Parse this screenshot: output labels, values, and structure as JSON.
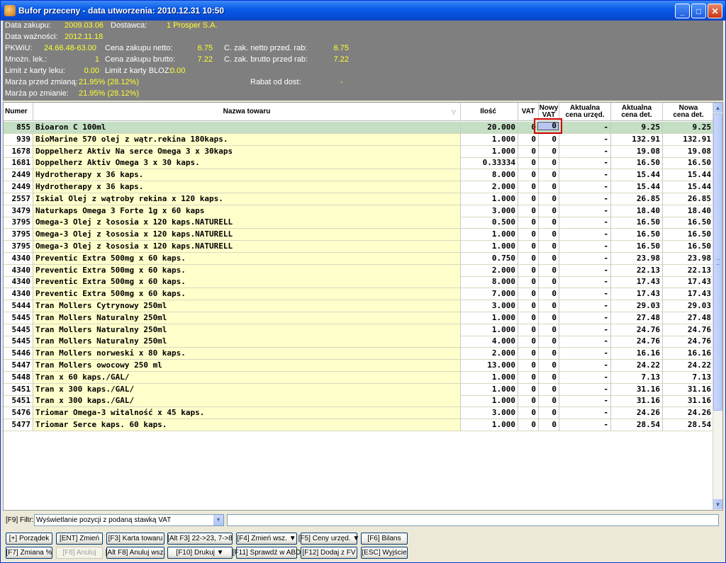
{
  "window": {
    "title": "Bufor przeceny - data utworzenia: 2010.12.31 10:50",
    "minimize": "_",
    "maximize": "□",
    "close": "✕"
  },
  "info": {
    "data_zakupu_label": "Data zakupu:",
    "data_zakupu": "2009.03.06",
    "dostawca_label": "Dostawca:",
    "dostawca": "1 Prosper S.A.",
    "data_waznosci_label": "Data ważności:",
    "data_waznosci": "2012.11.18",
    "pkwiu_label": "PKWiU:",
    "pkwiu": "24.66.48-63.00",
    "cena_netto_label": "Cena zakupu netto:",
    "cena_netto": "6.75",
    "c_zak_netto_label": "C. zak. netto przed. rab:",
    "c_zak_netto": "6.75",
    "mnozn_label": "Mnożn. lek.:",
    "mnozn": "1",
    "cena_brutto_label": "Cena zakupu brutto:",
    "cena_brutto": "7.22",
    "c_zak_brutto_label": "C. zak. brutto przed rab:",
    "c_zak_brutto": "7.22",
    "limit_leku_label": "Limit z karty leku:",
    "limit_leku": "0.00",
    "limit_bloz_label": "Limit z karty BLOZ:",
    "limit_bloz": "0.00",
    "marza_przed_label": "Marża przed zmianą:",
    "marza_przed": "21.95% (28.12%)",
    "rabat_label": "Rabat od dost:",
    "rabat": "-",
    "marza_po_label": "Marża po zmianie:",
    "marza_po": "21.95% (28.12%)"
  },
  "table": {
    "headers": {
      "numer": "Numer",
      "nazwa": "Nazwa towaru",
      "ilosc": "Ilość",
      "vat": "VAT",
      "nowy_vat_1": "Nowy",
      "nowy_vat_2": "VAT",
      "akt_urz_1": "Aktualna",
      "akt_urz_2": "cena urzęd.",
      "akt_det_1": "Aktualna",
      "akt_det_2": "cena det.",
      "nowa_det_1": "Nowa",
      "nowa_det_2": "cena det."
    },
    "rows": [
      {
        "numer": "855",
        "nazwa": "Bioaron C 100ml",
        "ilosc": "20.000",
        "vat": "0",
        "nowy_vat": "0",
        "akt_urz": "-",
        "akt_det": "9.25",
        "nowa_det": "9.25"
      },
      {
        "numer": "939",
        "nazwa": "BioMarine 570 olej z wątr.rekina 180kaps.",
        "ilosc": "1.000",
        "vat": "0",
        "nowy_vat": "0",
        "akt_urz": "-",
        "akt_det": "132.91",
        "nowa_det": "132.91"
      },
      {
        "numer": "1678",
        "nazwa": "Doppelherz Aktiv Na serce Omega 3 x 30kaps",
        "ilosc": "1.000",
        "vat": "0",
        "nowy_vat": "0",
        "akt_urz": "-",
        "akt_det": "19.08",
        "nowa_det": "19.08"
      },
      {
        "numer": "1681",
        "nazwa": "Doppelherz Aktiv Omega 3 x 30 kaps.",
        "ilosc": "0.33334",
        "vat": "0",
        "nowy_vat": "0",
        "akt_urz": "-",
        "akt_det": "16.50",
        "nowa_det": "16.50"
      },
      {
        "numer": "2449",
        "nazwa": "Hydrotherapy x 36 kaps.",
        "ilosc": "8.000",
        "vat": "0",
        "nowy_vat": "0",
        "akt_urz": "-",
        "akt_det": "15.44",
        "nowa_det": "15.44"
      },
      {
        "numer": "2449",
        "nazwa": "Hydrotherapy x 36 kaps.",
        "ilosc": "2.000",
        "vat": "0",
        "nowy_vat": "0",
        "akt_urz": "-",
        "akt_det": "15.44",
        "nowa_det": "15.44"
      },
      {
        "numer": "2557",
        "nazwa": "Iskial Olej z wątroby rekina x 120 kaps.",
        "ilosc": "1.000",
        "vat": "0",
        "nowy_vat": "0",
        "akt_urz": "-",
        "akt_det": "26.85",
        "nowa_det": "26.85"
      },
      {
        "numer": "3479",
        "nazwa": "Naturkaps Omega 3 Forte 1g x 60 kaps",
        "ilosc": "3.000",
        "vat": "0",
        "nowy_vat": "0",
        "akt_urz": "-",
        "akt_det": "18.40",
        "nowa_det": "18.40"
      },
      {
        "numer": "3795",
        "nazwa": "Omega-3 Olej z łososia x 120 kaps.NATURELL",
        "ilosc": "0.500",
        "vat": "0",
        "nowy_vat": "0",
        "akt_urz": "-",
        "akt_det": "16.50",
        "nowa_det": "16.50"
      },
      {
        "numer": "3795",
        "nazwa": "Omega-3 Olej z łososia x 120 kaps.NATURELL",
        "ilosc": "1.000",
        "vat": "0",
        "nowy_vat": "0",
        "akt_urz": "-",
        "akt_det": "16.50",
        "nowa_det": "16.50"
      },
      {
        "numer": "3795",
        "nazwa": "Omega-3 Olej z łososia x 120 kaps.NATURELL",
        "ilosc": "1.000",
        "vat": "0",
        "nowy_vat": "0",
        "akt_urz": "-",
        "akt_det": "16.50",
        "nowa_det": "16.50"
      },
      {
        "numer": "4340",
        "nazwa": "Preventic Extra 500mg x 60 kaps.",
        "ilosc": "0.750",
        "vat": "0",
        "nowy_vat": "0",
        "akt_urz": "-",
        "akt_det": "23.98",
        "nowa_det": "23.98"
      },
      {
        "numer": "4340",
        "nazwa": "Preventic Extra 500mg x 60 kaps.",
        "ilosc": "2.000",
        "vat": "0",
        "nowy_vat": "0",
        "akt_urz": "-",
        "akt_det": "22.13",
        "nowa_det": "22.13"
      },
      {
        "numer": "4340",
        "nazwa": "Preventic Extra 500mg x 60 kaps.",
        "ilosc": "8.000",
        "vat": "0",
        "nowy_vat": "0",
        "akt_urz": "-",
        "akt_det": "17.43",
        "nowa_det": "17.43"
      },
      {
        "numer": "4340",
        "nazwa": "Preventic Extra 500mg x 60 kaps.",
        "ilosc": "7.000",
        "vat": "0",
        "nowy_vat": "0",
        "akt_urz": "-",
        "akt_det": "17.43",
        "nowa_det": "17.43"
      },
      {
        "numer": "5444",
        "nazwa": "Tran Mollers Cytrynowy 250ml",
        "ilosc": "3.000",
        "vat": "0",
        "nowy_vat": "0",
        "akt_urz": "-",
        "akt_det": "29.03",
        "nowa_det": "29.03"
      },
      {
        "numer": "5445",
        "nazwa": "Tran Mollers Naturalny 250ml",
        "ilosc": "1.000",
        "vat": "0",
        "nowy_vat": "0",
        "akt_urz": "-",
        "akt_det": "27.48",
        "nowa_det": "27.48"
      },
      {
        "numer": "5445",
        "nazwa": "Tran Mollers Naturalny 250ml",
        "ilosc": "1.000",
        "vat": "0",
        "nowy_vat": "0",
        "akt_urz": "-",
        "akt_det": "24.76",
        "nowa_det": "24.76"
      },
      {
        "numer": "5445",
        "nazwa": "Tran Mollers Naturalny 250ml",
        "ilosc": "4.000",
        "vat": "0",
        "nowy_vat": "0",
        "akt_urz": "-",
        "akt_det": "24.76",
        "nowa_det": "24.76"
      },
      {
        "numer": "5446",
        "nazwa": "Tran Mollers norweski x 80 kaps.",
        "ilosc": "2.000",
        "vat": "0",
        "nowy_vat": "0",
        "akt_urz": "-",
        "akt_det": "16.16",
        "nowa_det": "16.16"
      },
      {
        "numer": "5447",
        "nazwa": "Tran Mollers owocowy 250 ml",
        "ilosc": "13.000",
        "vat": "0",
        "nowy_vat": "0",
        "akt_urz": "-",
        "akt_det": "24.22",
        "nowa_det": "24.22"
      },
      {
        "numer": "5448",
        "nazwa": "Tran x  60 kaps./GAL/",
        "ilosc": "1.000",
        "vat": "0",
        "nowy_vat": "0",
        "akt_urz": "-",
        "akt_det": "7.13",
        "nowa_det": "7.13"
      },
      {
        "numer": "5451",
        "nazwa": "Tran x 300 kaps./GAL/",
        "ilosc": "1.000",
        "vat": "0",
        "nowy_vat": "0",
        "akt_urz": "-",
        "akt_det": "31.16",
        "nowa_det": "31.16"
      },
      {
        "numer": "5451",
        "nazwa": "Tran x 300 kaps./GAL/",
        "ilosc": "1.000",
        "vat": "0",
        "nowy_vat": "0",
        "akt_urz": "-",
        "akt_det": "31.16",
        "nowa_det": "31.16"
      },
      {
        "numer": "5476",
        "nazwa": "Triomar Omega-3 witalność x 45 kaps.",
        "ilosc": "3.000",
        "vat": "0",
        "nowy_vat": "0",
        "akt_urz": "-",
        "akt_det": "24.26",
        "nowa_det": "24.26"
      },
      {
        "numer": "5477",
        "nazwa": "Triomar Serce kaps. 60 kaps.",
        "ilosc": "1.000",
        "vat": "0",
        "nowy_vat": "0",
        "akt_urz": "-",
        "akt_det": "28.54",
        "nowa_det": "28.54"
      }
    ]
  },
  "filter": {
    "label": "[F9] Filtr:",
    "value": "Wyświetlanie pozycji z podaną stawką VAT"
  },
  "buttons": {
    "porzadek": "[+] Porządek",
    "zmien": "[ENT] Zmień",
    "karta": "[F3] Karta towaru",
    "alt_f3": "[Alt F3] 22->23, 7->8",
    "zmien_wsz": "[F4] Zmień wsz. ▼",
    "ceny_urzed": "[F5] Ceny urzęd. ▼",
    "bilans": "[F6] Bilans",
    "zmiana_proc": "[F7] Zmiana %",
    "anuluj": "[F8] Anuluj",
    "anuluj_wsz": "[Alt F8] Anuluj wsz.",
    "drukuj": "[F10] Drukuj ▼",
    "sprawdz": "[F11] Sprawdź w ABD",
    "dodaj_fv": "[F12] Dodaj z  FV",
    "wyjscie": "[ESC] Wyjście"
  }
}
